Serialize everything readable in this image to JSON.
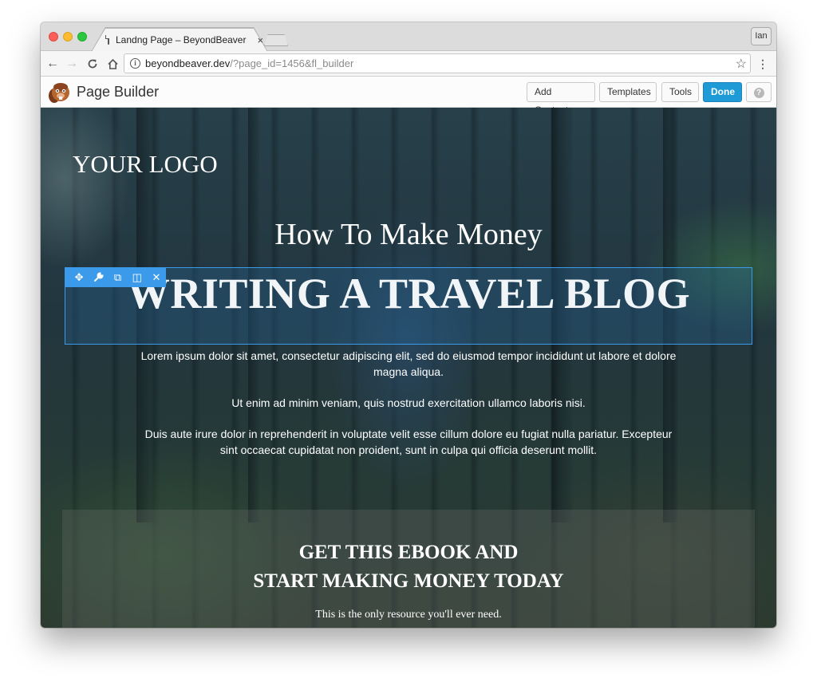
{
  "browser": {
    "tab_title": "Landng Page – BeyondBeaver",
    "tab_close": "×",
    "profile": "Ian",
    "url_host": "beyondbeaver.dev",
    "url_path": "/?page_id=1456&fl_builder",
    "icons": {
      "back": "←",
      "forward": "→",
      "reload": "↻",
      "home": "⌂",
      "info": "i",
      "star": "☆",
      "menu": "⋮"
    }
  },
  "page_builder": {
    "title": "Page Builder",
    "buttons": {
      "add_content": "Add Content",
      "templates": "Templates",
      "tools": "Tools",
      "done": "Done",
      "help": "?"
    },
    "accent_color": "#1e9bd7"
  },
  "module_toolbar": {
    "icons": {
      "move": "✥",
      "settings": "🔧",
      "duplicate": "⧉",
      "columns": "◫",
      "remove": "✕"
    },
    "selection_color": "#3b9bea"
  },
  "hero": {
    "logo": "YOUR LOGO",
    "subtitle": "How To Make Money",
    "title": "WRITING A TRAVEL BLOG",
    "paragraphs": [
      "Lorem ipsum dolor sit amet, consectetur adipiscing elit, sed do eiusmod tempor incididunt ut labore et dolore magna aliqua.",
      "Ut enim ad minim veniam, quis nostrud exercitation ullamco laboris nisi.",
      "Duis aute irure dolor in reprehenderit in voluptate velit esse cillum dolore eu fugiat nulla pariatur. Excepteur sint occaecat cupidatat non proident, sunt in culpa qui officia deserunt mollit."
    ]
  },
  "cta": {
    "title_line1": "GET THIS EBOOK AND",
    "title_line2": "START MAKING MONEY TODAY",
    "subtitle": "This is the only resource you'll ever need."
  }
}
